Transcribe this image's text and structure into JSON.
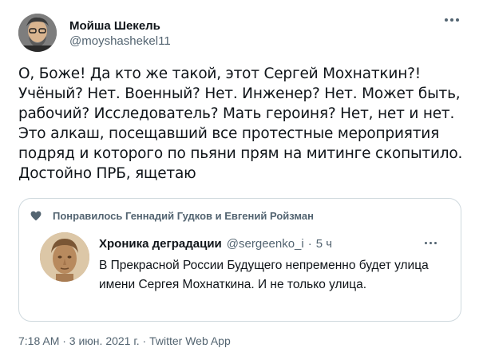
{
  "author": {
    "name": "Мойша Шекель",
    "handle": "@moyshashekel11"
  },
  "tweet": {
    "text": "О, Боже! Да кто же такой, этот Сергей Мохнаткин?! Учёный? Нет. Военный? Нет. Инженер? Нет. Может быть, рабочий? Исследователь? Мать героиня? Нет, нет и нет. Это алкаш, посещавший все протестные мероприятия подряд и которого по пьяни прям на митинге скопытило. Достойно ПРБ, ящетаю"
  },
  "quote": {
    "liked_by": "Понравилось Геннадий Гудков и Евгений Ройзман",
    "name": "Хроника деградации",
    "handle": "@sergeenko_i",
    "dot": "·",
    "time": "5 ч",
    "text": "В Прекрасной России Будущего непременно будет улица имени Сергея Мохнаткина. И не только улица."
  },
  "meta": {
    "line": "7:18 AM · 3 июн. 2021 г. · Twitter Web App"
  },
  "icons": {
    "more": "more-icon",
    "heart": "heart-icon"
  },
  "colors": {
    "text": "#0f1419",
    "secondary": "#536471",
    "border": "#cfd9de"
  }
}
